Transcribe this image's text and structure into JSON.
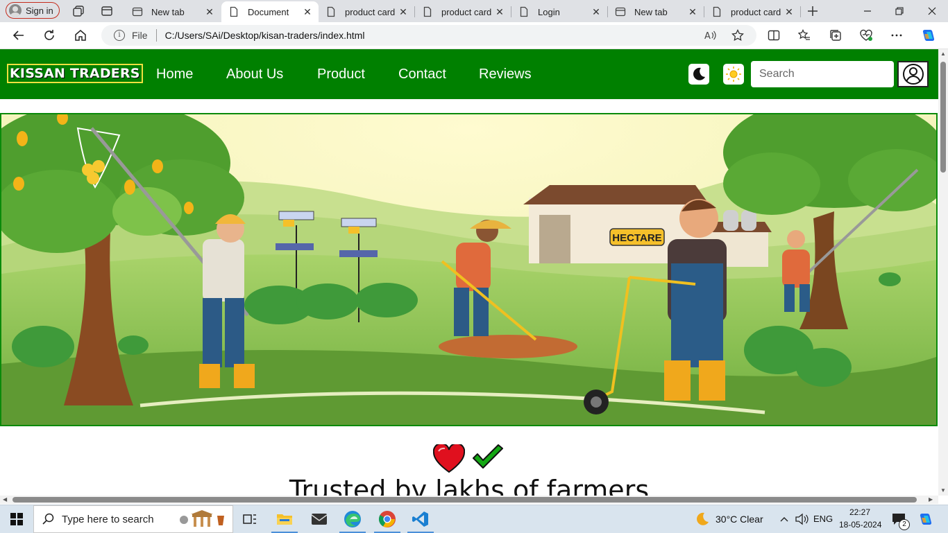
{
  "browser": {
    "signin_label": "Sign in",
    "tabs": [
      {
        "label": "New tab",
        "icon": "newtab-icon",
        "active": false
      },
      {
        "label": "Document",
        "icon": "page-icon",
        "active": true
      },
      {
        "label": "product card",
        "icon": "page-icon",
        "active": false
      },
      {
        "label": "product card",
        "icon": "page-icon",
        "active": false
      },
      {
        "label": "Login",
        "icon": "page-icon",
        "active": false
      },
      {
        "label": "New tab",
        "icon": "newtab-icon",
        "active": false
      },
      {
        "label": "product card",
        "icon": "page-icon",
        "active": false
      }
    ],
    "address": {
      "scheme_label": "File",
      "url": "C:/Users/SAi/Desktop/kisan-traders/index.html"
    }
  },
  "site": {
    "brand": "KISSAN TRADERS",
    "nav": [
      "Home",
      "About Us",
      "Product",
      "Contact",
      "Reviews"
    ],
    "search_placeholder": "Search",
    "hero_sign": "HECTARE",
    "trust_title": "Trusted by lakhs of farmers",
    "colors": {
      "nav_bg": "#008000",
      "brand_border": "#f0e040",
      "heart": "#e0101e",
      "check": "#14a814"
    }
  },
  "taskbar": {
    "search_placeholder": "Type here to search",
    "weather": "30°C  Clear",
    "language": "ENG",
    "time": "22:27",
    "date": "18-05-2024",
    "notification_count": "2"
  }
}
